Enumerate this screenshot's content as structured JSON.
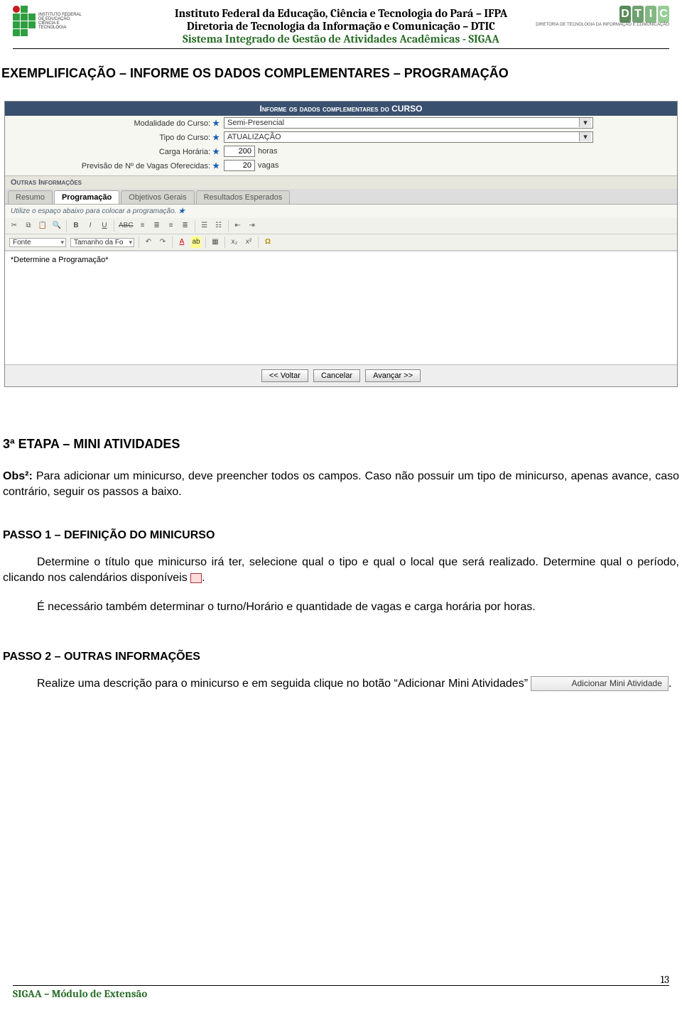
{
  "header": {
    "line1": "Instituto Federal da Educação, Ciência e Tecnologia do Pará – IFPA",
    "line2": "Diretoria de Tecnologia da Informação e Comunicação – DTIC",
    "line3": "Sistema Integrado de Gestão de Atividades Acadêmicas - SIGAA",
    "ifpa_caption": "INSTITUTO FEDERAL DE EDUCAÇÃO, CIÊNCIA E TECNOLOGIA",
    "dtic_letters": [
      "D",
      "T",
      "I",
      "C"
    ],
    "dtic_caption": "DIRETORIA DE TECNOLOGIA DA INFORMAÇÃO E COMUNICAÇÃO"
  },
  "section_title": "EXEMPLIFICAÇÃO – INFORME OS DADOS COMPLEMENTARES – PROGRAMAÇÃO",
  "form": {
    "title": "Informe os dados complementares do CURSO",
    "rows": {
      "modalidade_label": "Modalidade do Curso:",
      "modalidade_value": "Semi-Presencial",
      "tipo_label": "Tipo do Curso:",
      "tipo_value": "ATUALIZAÇÃO",
      "carga_label": "Carga Horária:",
      "carga_value": "200",
      "carga_unit": "horas",
      "vagas_label": "Previsão de Nº de Vagas Oferecidas:",
      "vagas_value": "20",
      "vagas_unit": "vagas"
    },
    "sub_header": "Outras Informações",
    "tabs": [
      "Resumo",
      "Programação",
      "Objetivos Gerais",
      "Resultados Esperados"
    ],
    "tab_note": "Utilize o espaço abaixo para colocar a programação.",
    "toolbar_font_label": "Fonte",
    "toolbar_size_label": "Tamanho da Fo",
    "editor_placeholder": "*Determine a Programação*",
    "btn_back": "<< Voltar",
    "btn_cancel": "Cancelar",
    "btn_next": "Avançar >>"
  },
  "body": {
    "etapa_title": "3ª ETAPA – MINI ATIVIDADES",
    "obs_label": "Obs²:",
    "obs_text": " Para adicionar um minicurso, deve preencher todos os campos. Caso não possuir um tipo de minicurso, apenas avance, caso contrário, seguir os passos a baixo.",
    "passo1_title": "PASSO 1 – DEFINIÇÃO DO MINICURSO",
    "passo1_p1": "Determine o título que minicurso irá ter, selecione qual o tipo e qual o local que será realizado. Determine qual o período, clicando nos calendários disponíveis ",
    "passo1_p2": "É necessário também determinar o turno/Horário e quantidade de vagas e carga horária por horas.",
    "passo2_title": "PASSO 2 – OUTRAS INFORMAÇÕES",
    "passo2_p_pre": "Realize uma descrição para o minicurso e em seguida clique no botão “Adicionar Mini Atividades” ",
    "mini_btn_label": "Adicionar Mini Atividade",
    "period": "."
  },
  "footer": {
    "text": "SIGAA – Módulo de Extensão",
    "page": "13"
  }
}
